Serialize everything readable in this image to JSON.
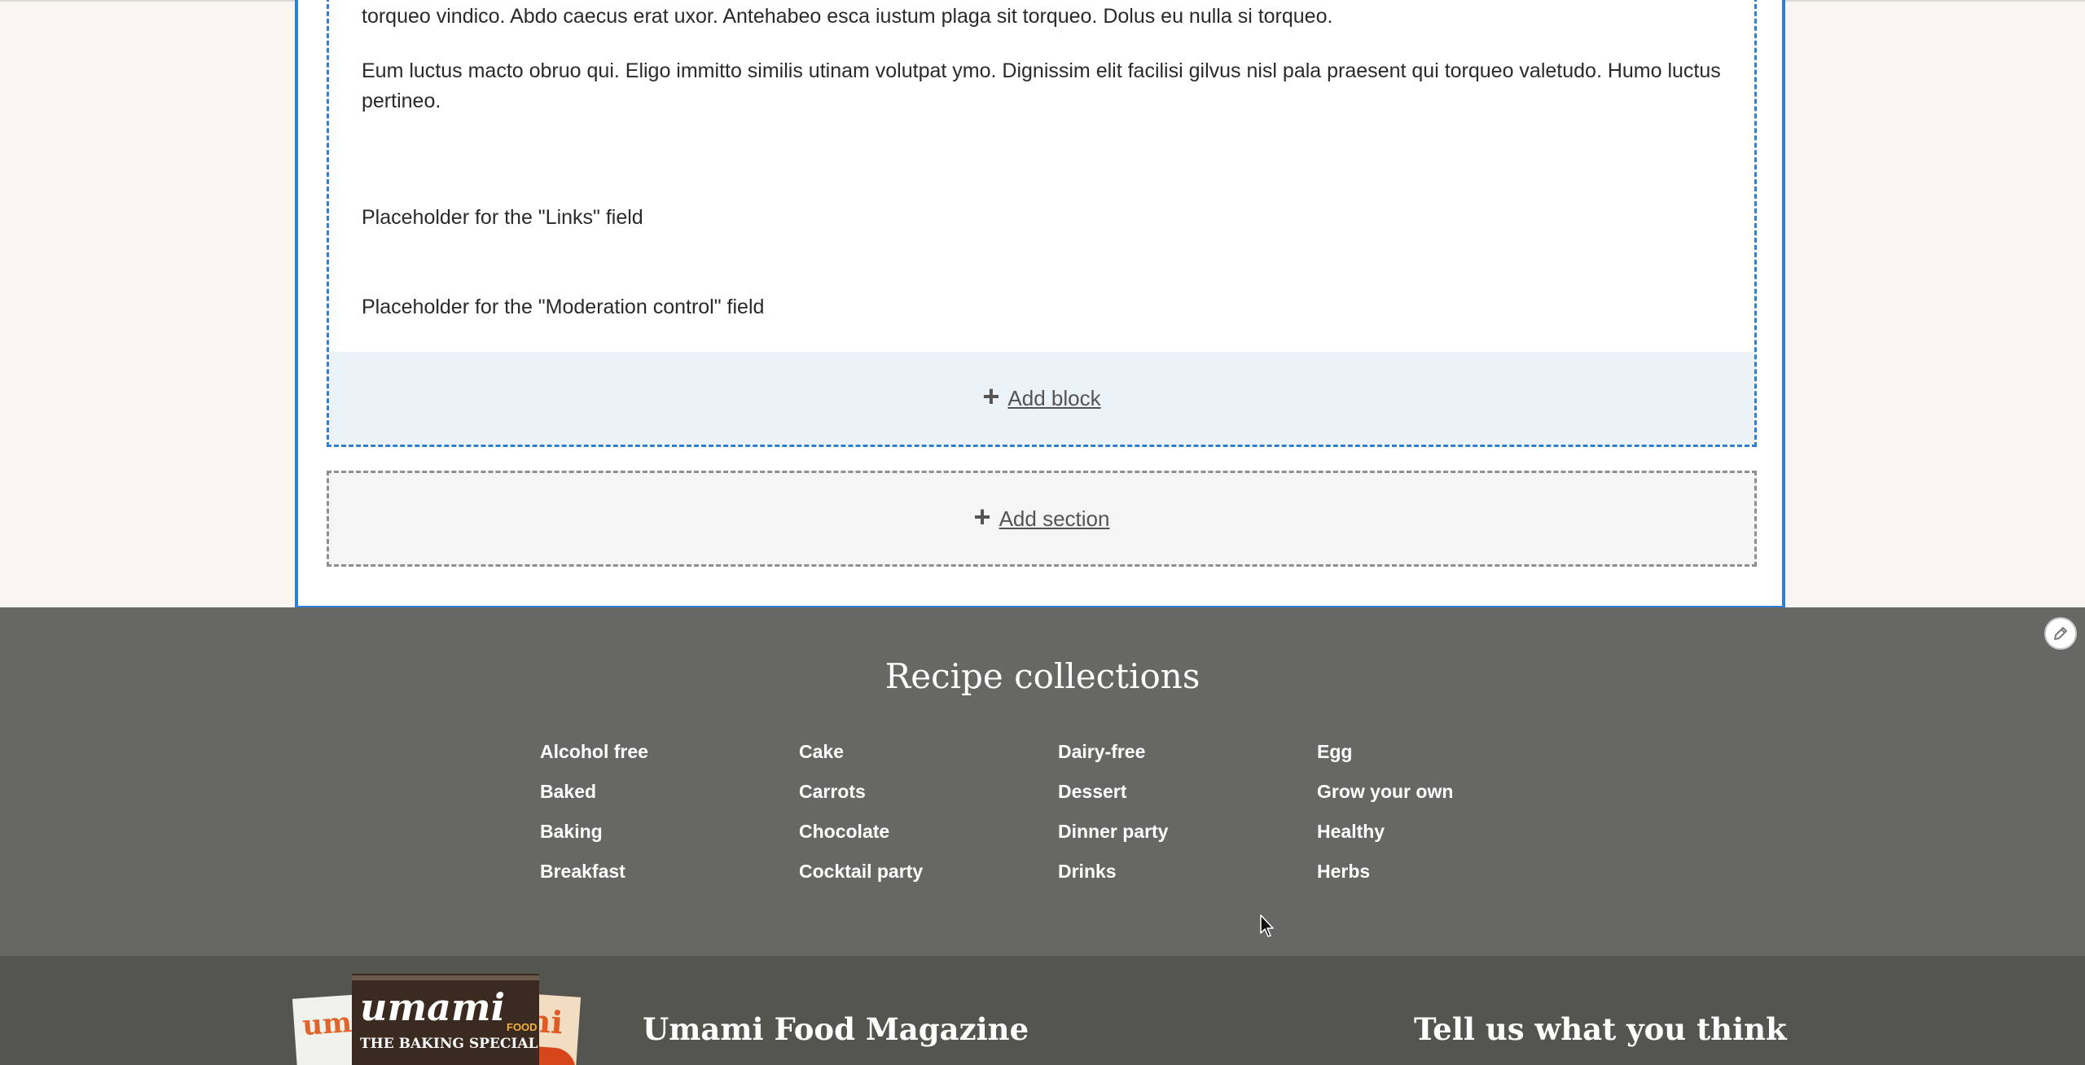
{
  "content": {
    "paragraph_1": "torqueo vindico. Abdo caecus erat uxor. Antehabeo esca iustum plaga sit torqueo. Dolus eu nulla si torqueo.",
    "paragraph_2": "Eum luctus macto obruo qui. Eligo immitto similis utinam volutpat ymo. Dignissim elit facilisi gilvus nisl pala praesent qui torqueo valetudo. Humo luctus pertineo.",
    "links_placeholder": "Placeholder for the \"Links\" field",
    "moderation_placeholder": "Placeholder for the \"Moderation control\" field"
  },
  "layout_builder": {
    "add_block_label": "Add block",
    "add_section_label": "Add section"
  },
  "collections": {
    "title": "Recipe collections",
    "columns": [
      [
        "Alcohol free",
        "Baked",
        "Baking",
        "Breakfast"
      ],
      [
        "Cake",
        "Carrots",
        "Chocolate",
        "Cocktail party"
      ],
      [
        "Dairy-free",
        "Dessert",
        "Dinner party",
        "Drinks"
      ],
      [
        "Egg",
        "Grow your own",
        "Healthy",
        "Herbs"
      ]
    ]
  },
  "footer": {
    "magazine_title": "Umami Food Magazine",
    "feedback_title": "Tell us what you think",
    "magazine_cover_left": "um",
    "magazine_cover_main": "umami",
    "magazine_cover_food": "FOOD",
    "magazine_cover_special": "THE BAKING SPECIAL",
    "magazine_cover_right": "ni"
  },
  "icons": {
    "plus": "plus-icon",
    "pencil": "pencil-icon",
    "cursor": "mouse-cursor-icon"
  },
  "colors": {
    "accent_blue": "#2f80d1",
    "collections_bg": "#676865",
    "magazine_bg": "#54554f",
    "page_bg": "#f9f5f0"
  }
}
